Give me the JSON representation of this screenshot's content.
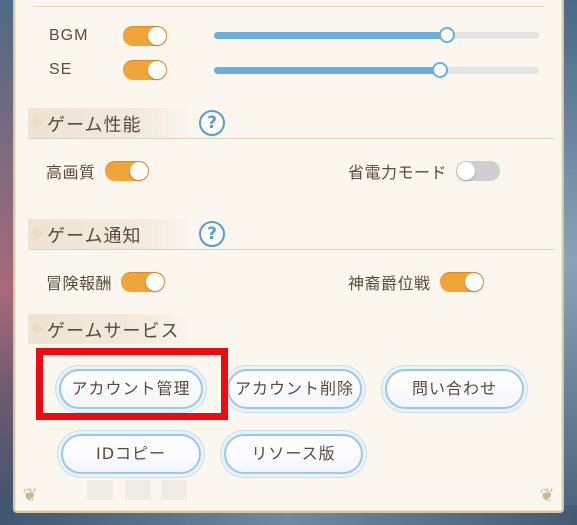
{
  "audio": {
    "bgm": {
      "label": "BGM",
      "enabled": true,
      "volume": 0.73
    },
    "se": {
      "label": "SE",
      "enabled": true,
      "volume": 0.71
    }
  },
  "performance": {
    "title": "ゲーム性能",
    "help_icon": "?",
    "options": [
      {
        "label": "高画質",
        "enabled": true
      },
      {
        "label": "省電力モード",
        "enabled": false
      }
    ]
  },
  "notifications": {
    "title": "ゲーム通知",
    "help_icon": "?",
    "options": [
      {
        "label": "冒険報酬",
        "enabled": true
      },
      {
        "label": "神裔爵位戦",
        "enabled": true
      }
    ]
  },
  "services": {
    "title": "ゲームサービス",
    "buttons": [
      {
        "label": "アカウント管理"
      },
      {
        "label": "アカウント削除"
      },
      {
        "label": "問い合わせ"
      },
      {
        "label": "IDコピー"
      },
      {
        "label": "リソース版"
      }
    ]
  },
  "colors": {
    "toggle_on": "#f0a43a",
    "toggle_off": "#cfcfcf",
    "slider_fill": "#6aaede",
    "highlight": "#ea0b13",
    "help_icon": "#5b9bd4"
  }
}
